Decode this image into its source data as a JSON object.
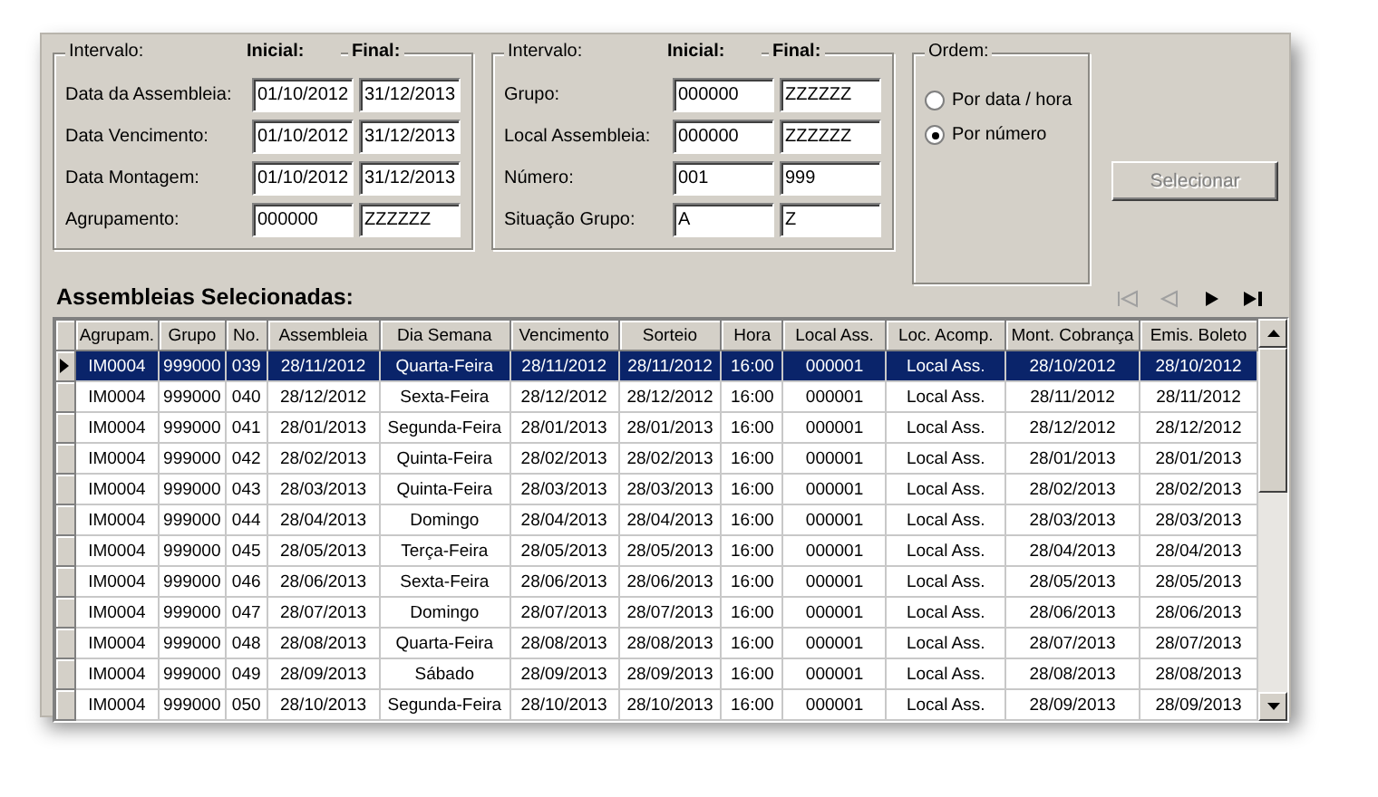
{
  "filters": [
    {
      "headings": [
        "Intervalo:",
        "Inicial:",
        "Final:"
      ],
      "rows": [
        {
          "label": "Data da Assembleia:",
          "from": "01/10/2012",
          "to": "31/12/2013"
        },
        {
          "label": "Data Vencimento:",
          "from": "01/10/2012",
          "to": "31/12/2013"
        },
        {
          "label": "Data Montagem:",
          "from": "01/10/2012",
          "to": "31/12/2013"
        },
        {
          "label": "Agrupamento:",
          "from": "000000",
          "to": "ZZZZZZ"
        }
      ]
    },
    {
      "headings": [
        "Intervalo:",
        "Inicial:",
        "Final:"
      ],
      "rows": [
        {
          "label": "Grupo:",
          "from": "000000",
          "to": "ZZZZZZ"
        },
        {
          "label": "Local Assembleia:",
          "from": "000000",
          "to": "ZZZZZZ"
        },
        {
          "label": "Número:",
          "from": "001",
          "to": "999"
        },
        {
          "label": "Situação Grupo:",
          "from": "A",
          "to": "Z"
        }
      ]
    }
  ],
  "order": {
    "title": "Ordem:",
    "options": [
      {
        "label": "Por data / hora",
        "selected": false
      },
      {
        "label": "Por número",
        "selected": true
      }
    ]
  },
  "select_button": {
    "label": "Selecionar",
    "disabled": true
  },
  "results": {
    "title": "Assembleias Selecionadas:",
    "nav": [
      {
        "kind": "first",
        "disabled": true
      },
      {
        "kind": "prev",
        "disabled": true
      },
      {
        "kind": "next",
        "disabled": false
      },
      {
        "kind": "last",
        "disabled": false
      }
    ],
    "columns": [
      "Agrupam.",
      "Grupo",
      "No.",
      "Assembleia",
      "Dia Semana",
      "Vencimento",
      "Sorteio",
      "Hora",
      "Local Ass.",
      "Loc. Acomp.",
      "Mont. Cobrança",
      "Emis. Boleto"
    ],
    "rows": [
      {
        "selected": true,
        "cells": [
          "IM0004",
          "999000",
          "039",
          "28/11/2012",
          "Quarta-Feira",
          "28/11/2012",
          "28/11/2012",
          "16:00",
          "000001",
          "Local Ass.",
          "28/10/2012",
          "28/10/2012"
        ]
      },
      {
        "selected": false,
        "cells": [
          "IM0004",
          "999000",
          "040",
          "28/12/2012",
          "Sexta-Feira",
          "28/12/2012",
          "28/12/2012",
          "16:00",
          "000001",
          "Local Ass.",
          "28/11/2012",
          "28/11/2012"
        ]
      },
      {
        "selected": false,
        "cells": [
          "IM0004",
          "999000",
          "041",
          "28/01/2013",
          "Segunda-Feira",
          "28/01/2013",
          "28/01/2013",
          "16:00",
          "000001",
          "Local Ass.",
          "28/12/2012",
          "28/12/2012"
        ]
      },
      {
        "selected": false,
        "cells": [
          "IM0004",
          "999000",
          "042",
          "28/02/2013",
          "Quinta-Feira",
          "28/02/2013",
          "28/02/2013",
          "16:00",
          "000001",
          "Local Ass.",
          "28/01/2013",
          "28/01/2013"
        ]
      },
      {
        "selected": false,
        "cells": [
          "IM0004",
          "999000",
          "043",
          "28/03/2013",
          "Quinta-Feira",
          "28/03/2013",
          "28/03/2013",
          "16:00",
          "000001",
          "Local Ass.",
          "28/02/2013",
          "28/02/2013"
        ]
      },
      {
        "selected": false,
        "cells": [
          "IM0004",
          "999000",
          "044",
          "28/04/2013",
          "Domingo",
          "28/04/2013",
          "28/04/2013",
          "16:00",
          "000001",
          "Local Ass.",
          "28/03/2013",
          "28/03/2013"
        ]
      },
      {
        "selected": false,
        "cells": [
          "IM0004",
          "999000",
          "045",
          "28/05/2013",
          "Terça-Feira",
          "28/05/2013",
          "28/05/2013",
          "16:00",
          "000001",
          "Local Ass.",
          "28/04/2013",
          "28/04/2013"
        ]
      },
      {
        "selected": false,
        "cells": [
          "IM0004",
          "999000",
          "046",
          "28/06/2013",
          "Sexta-Feira",
          "28/06/2013",
          "28/06/2013",
          "16:00",
          "000001",
          "Local Ass.",
          "28/05/2013",
          "28/05/2013"
        ]
      },
      {
        "selected": false,
        "cells": [
          "IM0004",
          "999000",
          "047",
          "28/07/2013",
          "Domingo",
          "28/07/2013",
          "28/07/2013",
          "16:00",
          "000001",
          "Local Ass.",
          "28/06/2013",
          "28/06/2013"
        ]
      },
      {
        "selected": false,
        "cells": [
          "IM0004",
          "999000",
          "048",
          "28/08/2013",
          "Quarta-Feira",
          "28/08/2013",
          "28/08/2013",
          "16:00",
          "000001",
          "Local Ass.",
          "28/07/2013",
          "28/07/2013"
        ]
      },
      {
        "selected": false,
        "cells": [
          "IM0004",
          "999000",
          "049",
          "28/09/2013",
          "Sábado",
          "28/09/2013",
          "28/09/2013",
          "16:00",
          "000001",
          "Local Ass.",
          "28/08/2013",
          "28/08/2013"
        ]
      },
      {
        "selected": false,
        "cells": [
          "IM0004",
          "999000",
          "050",
          "28/10/2013",
          "Segunda-Feira",
          "28/10/2013",
          "28/10/2013",
          "16:00",
          "000001",
          "Local Ass.",
          "28/09/2013",
          "28/09/2013"
        ]
      }
    ]
  }
}
